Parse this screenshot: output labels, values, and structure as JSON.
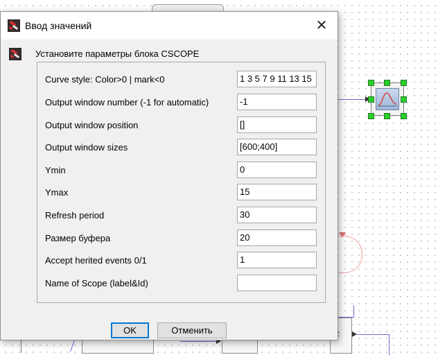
{
  "dialog": {
    "title": "Ввод значений",
    "close_glyph": "✕",
    "header": "Установите параметры блока CSCOPE",
    "fields": [
      {
        "label": "Curve style: Color>0 | mark<0",
        "value": "1 3 5 7 9 11 13 15"
      },
      {
        "label": "Output window number (-1 for automatic)",
        "value": "-1"
      },
      {
        "label": "Output window position",
        "value": "[]"
      },
      {
        "label": "Output window sizes",
        "value": "[600;400]"
      },
      {
        "label": "Ymin",
        "value": "0"
      },
      {
        "label": "Ymax",
        "value": "15"
      },
      {
        "label": "Refresh period",
        "value": "30"
      },
      {
        "label": "Размер буфера",
        "value": "20"
      },
      {
        "label": "Accept herited events 0/1",
        "value": "1"
      },
      {
        "label": "Name of Scope (label&Id)",
        "value": ""
      }
    ],
    "ok_label": "OK",
    "cancel_label": "Отменить"
  },
  "canvas": {
    "partial_text": "z"
  },
  "icons": {
    "app": "scilab-xcos-icon",
    "close": "close-icon",
    "block": "cscope-block-icon"
  },
  "colors": {
    "selection_handle": "#2ecc2e",
    "link": "#6a6ad8",
    "ok_focus": "#0078d7"
  }
}
